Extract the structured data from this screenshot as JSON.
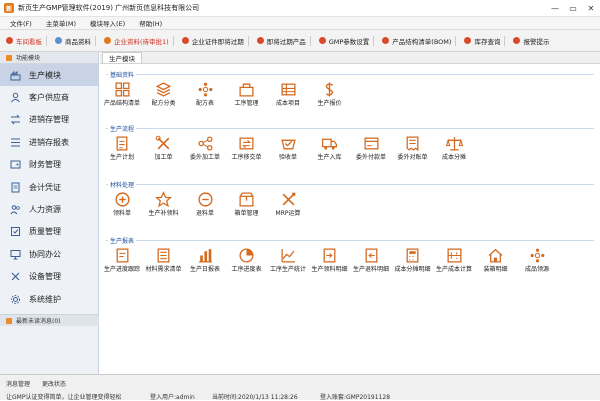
{
  "window": {
    "title": "新页生产GMP管理软件(2019) 广州新页信息科技有限公司",
    "logo_text": "新"
  },
  "menu": [
    "文件(F)",
    "主菜单(M)",
    "模块导入(E)",
    "帮助(H)"
  ],
  "toolbar": [
    {
      "label": "车间看板",
      "color": "#d03020",
      "highlight": true
    },
    {
      "label": "商品资料",
      "color": "#d03020",
      "highlight": false
    },
    {
      "label": "企业资料(待审批1)",
      "color": "#d03020",
      "highlight": true
    },
    {
      "label": "企业证件即将过期",
      "color": "#d03020",
      "highlight": false
    },
    {
      "label": "即将过期产品",
      "color": "#d03020",
      "highlight": false
    },
    {
      "label": "GMP参数设置",
      "color": "#d03020",
      "highlight": false
    },
    {
      "label": "产品结构清单(BOM)",
      "color": "#d03020",
      "highlight": false
    },
    {
      "label": "库存查询",
      "color": "#d03020",
      "highlight": false
    },
    {
      "label": "报警提示",
      "color": "#d03020",
      "highlight": false
    }
  ],
  "sidebar": {
    "header": "功能模块",
    "items": [
      {
        "label": "生产模块",
        "icon": "factory-icon",
        "active": true
      },
      {
        "label": "客户供应商",
        "icon": "person-icon",
        "active": false
      },
      {
        "label": "进销存管理",
        "icon": "swap-icon",
        "active": false
      },
      {
        "label": "进销存报表",
        "icon": "list-icon",
        "active": false
      },
      {
        "label": "财务管理",
        "icon": "wallet-icon",
        "active": false
      },
      {
        "label": "会计凭证",
        "icon": "document-icon",
        "active": false
      },
      {
        "label": "人力资源",
        "icon": "people-icon",
        "active": false
      },
      {
        "label": "质量管理",
        "icon": "quality-icon",
        "active": false
      },
      {
        "label": "协同办公",
        "icon": "monitor-icon",
        "active": false
      },
      {
        "label": "设备管理",
        "icon": "tools-icon",
        "active": false
      },
      {
        "label": "系统维护",
        "icon": "gear-icon",
        "active": false
      }
    ],
    "message": "最新未读消息(0)"
  },
  "main": {
    "tab": "生产模块",
    "accent": "#d46a1f",
    "sections": [
      {
        "title": "基础资料",
        "tiles": [
          {
            "label": "产品结构清单",
            "icon": "grid-icon"
          },
          {
            "label": "配方分类",
            "icon": "layers-icon"
          },
          {
            "label": "配方表",
            "icon": "dots-icon"
          },
          {
            "label": "工序管理",
            "icon": "process-icon"
          },
          {
            "label": "成本项目",
            "icon": "table-icon"
          },
          {
            "label": "生产报价",
            "icon": "dollar-icon"
          }
        ]
      },
      {
        "title": "生产流程",
        "tiles": [
          {
            "label": "生产计划",
            "icon": "doc-edit-icon"
          },
          {
            "label": "加工单",
            "icon": "tools-icon"
          },
          {
            "label": "委外加工单",
            "icon": "share-icon"
          },
          {
            "label": "工序移交单",
            "icon": "transfer-icon"
          },
          {
            "label": "验收单",
            "icon": "check-icon"
          },
          {
            "label": "生产入库",
            "icon": "truck-icon"
          },
          {
            "label": "委外付款单",
            "icon": "payment-icon"
          },
          {
            "label": "委外对账单",
            "icon": "receipt-icon"
          },
          {
            "label": "成本分摊",
            "icon": "scale-icon"
          }
        ]
      },
      {
        "title": "材料处理",
        "tiles": [
          {
            "label": "领料单",
            "icon": "plus-circle-icon"
          },
          {
            "label": "生产补领料",
            "icon": "star-icon"
          },
          {
            "label": "退料单",
            "icon": "minus-circle-icon"
          },
          {
            "label": "箱单管理",
            "icon": "box-icon"
          },
          {
            "label": "MRP运算",
            "icon": "cross-tools-icon"
          }
        ]
      },
      {
        "title": "生产报表",
        "tiles": [
          {
            "label": "生产进度跟踪",
            "icon": "doc-progress-icon"
          },
          {
            "label": "材料需求清单",
            "icon": "doc-list-icon"
          },
          {
            "label": "生产日报表",
            "icon": "bar-chart-icon"
          },
          {
            "label": "工序进度表",
            "icon": "pie-chart-icon"
          },
          {
            "label": "工序生产统计",
            "icon": "line-chart-icon"
          },
          {
            "label": "生产领料明细",
            "icon": "doc-in-icon"
          },
          {
            "label": "生产退料明细",
            "icon": "doc-out-icon"
          },
          {
            "label": "成本分摊明细",
            "icon": "calc-icon"
          },
          {
            "label": "生产成本计算",
            "icon": "calc-doc-icon"
          },
          {
            "label": "装箱明细",
            "icon": "house-icon"
          },
          {
            "label": "成品领源",
            "icon": "dots-icon"
          }
        ]
      }
    ]
  },
  "status": {
    "left1": "消息管理",
    "left2": "更改状态",
    "marquee": "让GMP认证变得简单，让企业管理变得轻松",
    "user": "登入用户:admin",
    "time": "当前时间:2020/1/13 11:28:26",
    "account": "登入账套:GMP20191128"
  }
}
